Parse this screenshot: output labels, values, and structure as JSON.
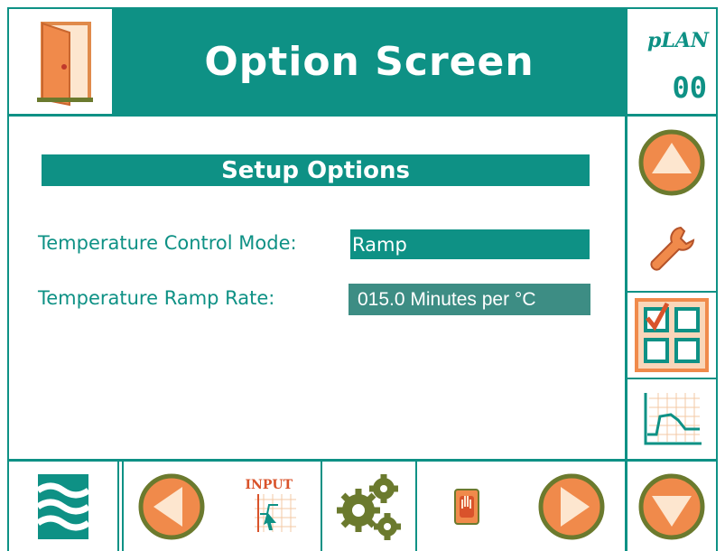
{
  "header": {
    "title": "Option Screen",
    "plan_label": "pLAN",
    "plan_number": "00"
  },
  "panel": {
    "title": "Setup Options",
    "fields": [
      {
        "label": "Temperature Control Mode:",
        "value": "Ramp"
      },
      {
        "label": "Temperature Ramp Rate:",
        "value": "015.0 Minutes per °C"
      }
    ]
  },
  "toolbar": {
    "input_label": "INPUT"
  },
  "icons": {
    "exit": "door-icon",
    "scroll_up": "up-arrow-icon",
    "service": "wrench-icon",
    "options": "checklist-grid-icon",
    "graph": "graph-icon",
    "scroll_down": "down-arrow-icon",
    "logo": "waves-logo-icon",
    "previous": "left-arrow-icon",
    "input": "input-graph-icon",
    "settings": "gears-icon",
    "stop": "hand-icon",
    "next": "right-arrow-icon"
  },
  "colors": {
    "teal": "#0e9185",
    "orange": "#f08a4b",
    "olive": "#6b7a2e",
    "highlight": "#f9d6b9"
  }
}
